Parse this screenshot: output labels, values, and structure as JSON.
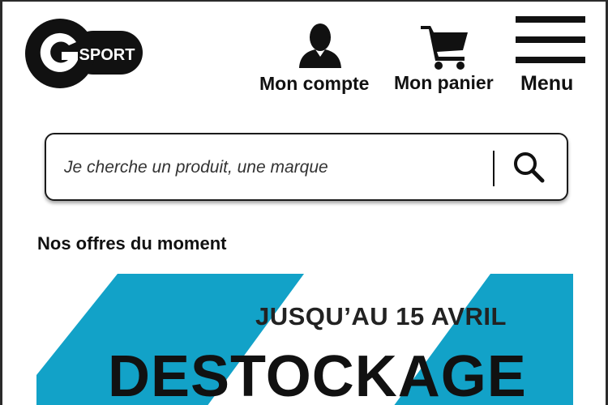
{
  "brand": {
    "logo_text": "SPORT",
    "logo_alt": "GO SPORT"
  },
  "nav": {
    "account_label": "Mon compte",
    "cart_label": "Mon panier",
    "menu_label": "Menu"
  },
  "search": {
    "placeholder": "Je cherche un produit, une marque"
  },
  "offers": {
    "title": "Nos offres du moment",
    "banner": {
      "date_text": "JUSQU’AU 15 AVRIL",
      "headline": "DESTOCKAGE",
      "accent_color": "#12a2c8"
    }
  },
  "colors": {
    "text": "#111111",
    "banner_blue": "#12a2c8",
    "logo_black": "#111111"
  }
}
